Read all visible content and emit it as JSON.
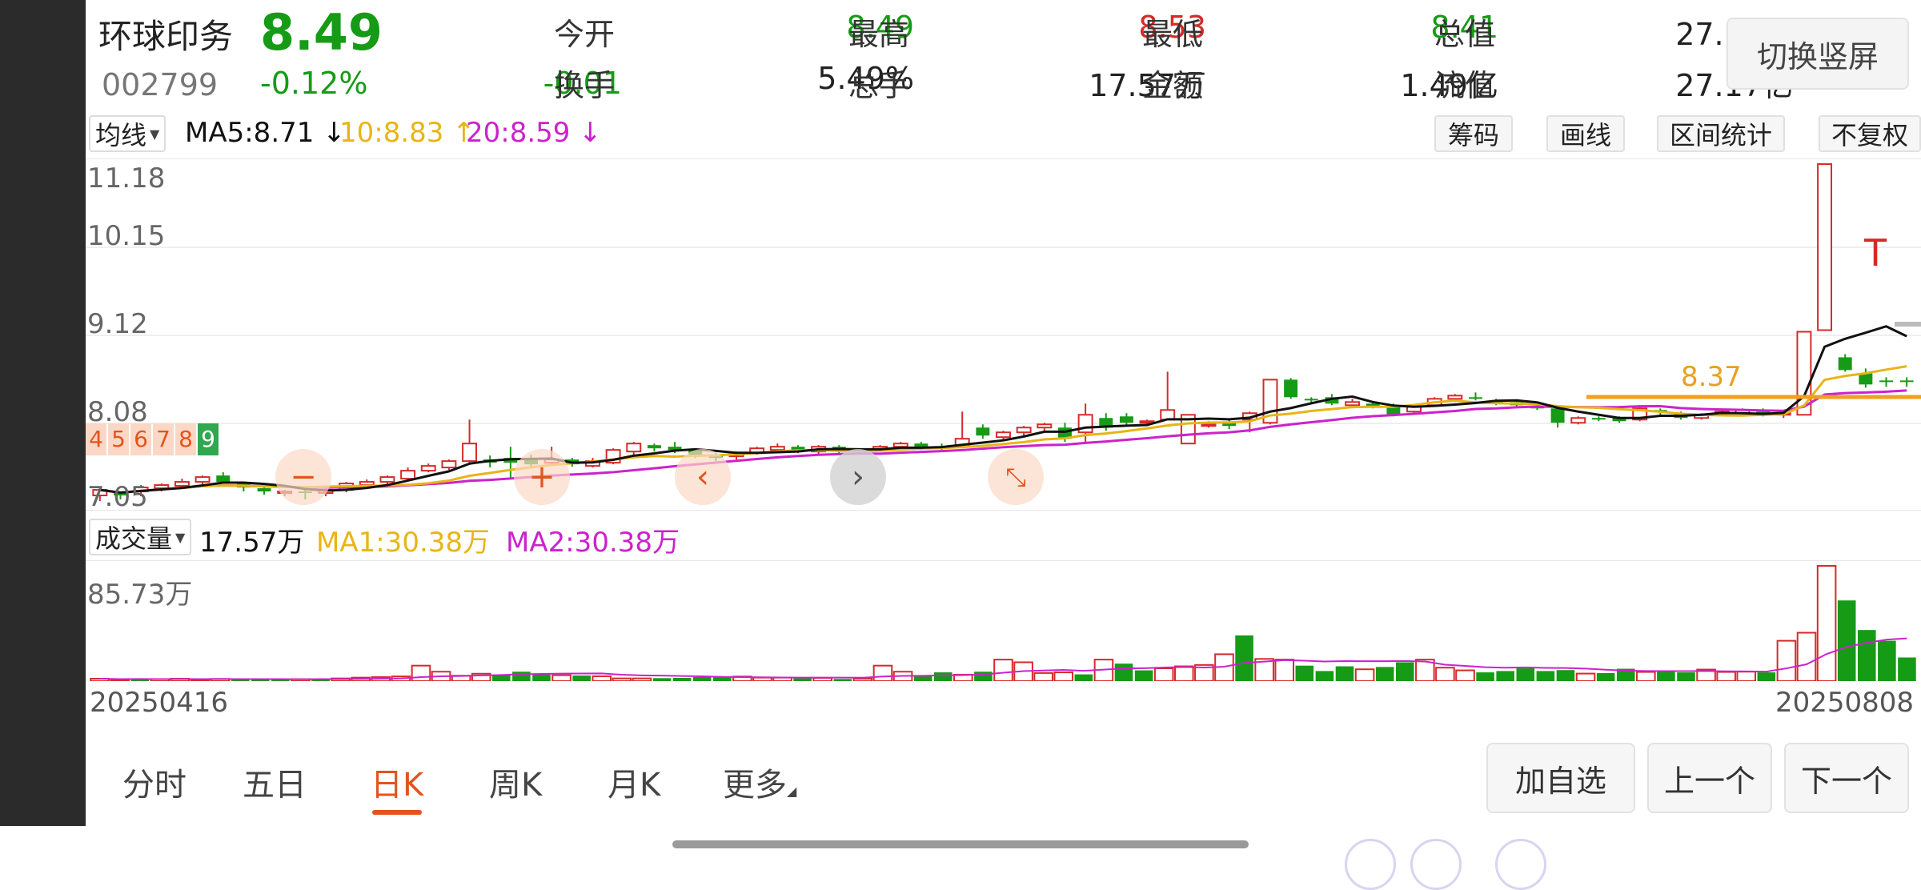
{
  "header": {
    "name": "环球印务",
    "price": "8.49",
    "code": "002799",
    "change_pct": "-0.12%",
    "change": "-0.01",
    "stats": [
      {
        "label": "今开",
        "value": "8.49",
        "color": "green"
      },
      {
        "label": "最高",
        "value": "8.53",
        "color": "red"
      },
      {
        "label": "最低",
        "value": "8.41",
        "color": "green"
      },
      {
        "label": "总值",
        "value": "27.17亿",
        "color": "black"
      },
      {
        "label": "换手",
        "value": "5.49%",
        "color": "black"
      },
      {
        "label": "总手",
        "value": "17.57万",
        "color": "black"
      },
      {
        "label": "金额",
        "value": "1.49亿",
        "color": "black"
      },
      {
        "label": "流值",
        "value": "27.17亿",
        "color": "black"
      }
    ],
    "switch_label": "切换竖屏"
  },
  "ma_legend": {
    "dropdown": "均线",
    "ma5": "MA5:8.71",
    "ma10": "10:8.83",
    "ma20": "20:8.59",
    "ma5_arrow": "↓",
    "ma10_arrow": "↑",
    "ma20_arrow": "↓"
  },
  "tools": [
    "筹码",
    "画线",
    "区间统计",
    "不复权"
  ],
  "price_axis": [
    "11.18",
    "10.15",
    "9.12",
    "8.08",
    "7.05"
  ],
  "overlay": {
    "numbers": [
      "4",
      "5",
      "6",
      "7",
      "8",
      "9"
    ],
    "price_marker": "8.37",
    "t_marker": "T",
    "icons": [
      "minus-icon",
      "plus-icon",
      "chevron-left-icon",
      "chevron-right-icon",
      "collapse-icon"
    ]
  },
  "volume_legend": {
    "dropdown": "成交量",
    "current": "17.57万",
    "ma1": "MA1:30.38万",
    "ma2": "MA2:30.38万"
  },
  "volume_axis_max": "85.73万",
  "dates": {
    "start": "20250416",
    "end": "20250808"
  },
  "tabs": [
    {
      "label": "分时",
      "active": false
    },
    {
      "label": "五日",
      "active": false
    },
    {
      "label": "日K",
      "active": true
    },
    {
      "label": "周K",
      "active": false
    },
    {
      "label": "月K",
      "active": false
    },
    {
      "label": "更多",
      "active": false
    }
  ],
  "actions": [
    "加自选",
    "上一个",
    "下一个"
  ],
  "colors": {
    "up": "#d62a2a",
    "down": "#169b16",
    "ma5": "#111111",
    "ma10": "#e8b516",
    "ma20": "#cc22cc",
    "accent": "#e3541c"
  },
  "chart_data": {
    "type": "candlestick",
    "ylim": [
      7.05,
      11.18
    ],
    "candles": [
      {
        "o": 7.05,
        "c": 7.12,
        "h": 7.15,
        "l": 6.98
      },
      {
        "o": 7.08,
        "c": 7.05,
        "h": 7.1,
        "l": 7.0
      },
      {
        "o": 7.1,
        "c": 7.15,
        "h": 7.18,
        "l": 7.04
      },
      {
        "o": 7.14,
        "c": 7.18,
        "h": 7.2,
        "l": 7.1
      },
      {
        "o": 7.17,
        "c": 7.22,
        "h": 7.26,
        "l": 7.14
      },
      {
        "o": 7.22,
        "c": 7.28,
        "h": 7.3,
        "l": 7.19
      },
      {
        "o": 7.3,
        "c": 7.22,
        "h": 7.34,
        "l": 7.2
      },
      {
        "o": 7.2,
        "c": 7.15,
        "h": 7.22,
        "l": 7.1
      },
      {
        "o": 7.14,
        "c": 7.1,
        "h": 7.16,
        "l": 7.06
      },
      {
        "o": 7.08,
        "c": 7.1,
        "h": 7.12,
        "l": 7.04
      },
      {
        "o": 7.1,
        "c": 7.08,
        "h": 7.14,
        "l": 7.0
      },
      {
        "o": 7.08,
        "c": 7.12,
        "h": 7.15,
        "l": 7.04
      },
      {
        "o": 7.12,
        "c": 7.2,
        "h": 7.22,
        "l": 7.09
      },
      {
        "o": 7.18,
        "c": 7.22,
        "h": 7.25,
        "l": 7.15
      },
      {
        "o": 7.22,
        "c": 7.28,
        "h": 7.3,
        "l": 7.19
      },
      {
        "o": 7.26,
        "c": 7.36,
        "h": 7.4,
        "l": 7.24
      },
      {
        "o": 7.36,
        "c": 7.42,
        "h": 7.45,
        "l": 7.34
      },
      {
        "o": 7.4,
        "c": 7.48,
        "h": 7.5,
        "l": 7.37
      },
      {
        "o": 7.48,
        "c": 7.7,
        "h": 8.0,
        "l": 7.45
      },
      {
        "o": 7.5,
        "c": 7.46,
        "h": 7.55,
        "l": 7.4
      },
      {
        "o": 7.52,
        "c": 7.46,
        "h": 7.66,
        "l": 7.25
      },
      {
        "o": 7.52,
        "c": 7.44,
        "h": 7.56,
        "l": 7.4
      },
      {
        "o": 7.46,
        "c": 7.5,
        "h": 7.66,
        "l": 7.42
      },
      {
        "o": 7.5,
        "c": 7.44,
        "h": 7.52,
        "l": 7.41
      },
      {
        "o": 7.42,
        "c": 7.48,
        "h": 7.52,
        "l": 7.4
      },
      {
        "o": 7.46,
        "c": 7.62,
        "h": 7.64,
        "l": 7.44
      },
      {
        "o": 7.6,
        "c": 7.7,
        "h": 7.72,
        "l": 7.56
      },
      {
        "o": 7.68,
        "c": 7.64,
        "h": 7.7,
        "l": 7.6
      },
      {
        "o": 7.66,
        "c": 7.62,
        "h": 7.72,
        "l": 7.58
      },
      {
        "o": 7.62,
        "c": 7.56,
        "h": 7.64,
        "l": 7.52
      },
      {
        "o": 7.56,
        "c": 7.52,
        "h": 7.58,
        "l": 7.48
      },
      {
        "o": 7.54,
        "c": 7.58,
        "h": 7.6,
        "l": 7.5
      },
      {
        "o": 7.58,
        "c": 7.64,
        "h": 7.66,
        "l": 7.56
      },
      {
        "o": 7.62,
        "c": 7.66,
        "h": 7.7,
        "l": 7.6
      },
      {
        "o": 7.66,
        "c": 7.6,
        "h": 7.68,
        "l": 7.58
      },
      {
        "o": 7.6,
        "c": 7.66,
        "h": 7.68,
        "l": 7.56
      },
      {
        "o": 7.66,
        "c": 7.6,
        "h": 7.68,
        "l": 7.56
      },
      {
        "o": 7.6,
        "c": 7.62,
        "h": 7.64,
        "l": 7.58
      },
      {
        "o": 7.62,
        "c": 7.66,
        "h": 7.68,
        "l": 7.6
      },
      {
        "o": 7.66,
        "c": 7.7,
        "h": 7.72,
        "l": 7.64
      },
      {
        "o": 7.7,
        "c": 7.66,
        "h": 7.72,
        "l": 7.62
      },
      {
        "o": 7.66,
        "c": 7.64,
        "h": 7.7,
        "l": 7.62
      },
      {
        "o": 7.66,
        "c": 7.76,
        "h": 8.1,
        "l": 7.64
      },
      {
        "o": 7.9,
        "c": 7.8,
        "h": 7.94,
        "l": 7.76
      },
      {
        "o": 7.78,
        "c": 7.84,
        "h": 7.86,
        "l": 7.74
      },
      {
        "o": 7.84,
        "c": 7.9,
        "h": 7.92,
        "l": 7.8
      },
      {
        "o": 7.9,
        "c": 7.94,
        "h": 7.96,
        "l": 7.86
      },
      {
        "o": 7.9,
        "c": 7.76,
        "h": 7.96,
        "l": 7.72
      },
      {
        "o": 7.84,
        "c": 8.06,
        "h": 8.2,
        "l": 7.7
      },
      {
        "o": 8.02,
        "c": 7.9,
        "h": 8.08,
        "l": 7.86
      },
      {
        "o": 8.04,
        "c": 7.96,
        "h": 8.08,
        "l": 7.92
      },
      {
        "o": 7.96,
        "c": 7.98,
        "h": 8.0,
        "l": 7.94
      },
      {
        "o": 8.0,
        "c": 8.12,
        "h": 8.6,
        "l": 8.0
      },
      {
        "o": 7.7,
        "c": 8.06,
        "h": 8.06,
        "l": 7.7
      },
      {
        "o": 7.92,
        "c": 7.94,
        "h": 7.98,
        "l": 7.9
      },
      {
        "o": 7.96,
        "c": 7.92,
        "h": 8.0,
        "l": 7.88
      },
      {
        "o": 8.0,
        "c": 8.08,
        "h": 8.1,
        "l": 7.84
      },
      {
        "o": 7.96,
        "c": 8.5,
        "h": 8.5,
        "l": 7.94
      },
      {
        "o": 8.5,
        "c": 8.28,
        "h": 8.52,
        "l": 8.26
      },
      {
        "o": 8.26,
        "c": 8.24,
        "h": 8.28,
        "l": 8.2
      },
      {
        "o": 8.28,
        "c": 8.2,
        "h": 8.32,
        "l": 8.18
      },
      {
        "o": 8.18,
        "c": 8.22,
        "h": 8.26,
        "l": 8.16
      },
      {
        "o": 8.2,
        "c": 8.16,
        "h": 8.22,
        "l": 8.14
      },
      {
        "o": 8.18,
        "c": 8.06,
        "h": 8.2,
        "l": 8.04
      },
      {
        "o": 8.1,
        "c": 8.16,
        "h": 8.18,
        "l": 8.06
      },
      {
        "o": 8.18,
        "c": 8.26,
        "h": 8.28,
        "l": 8.16
      },
      {
        "o": 8.26,
        "c": 8.3,
        "h": 8.32,
        "l": 8.22
      },
      {
        "o": 8.28,
        "c": 8.26,
        "h": 8.34,
        "l": 8.24
      },
      {
        "o": 8.24,
        "c": 8.2,
        "h": 8.26,
        "l": 8.18
      },
      {
        "o": 8.22,
        "c": 8.18,
        "h": 8.24,
        "l": 8.14
      },
      {
        "o": 8.16,
        "c": 8.14,
        "h": 8.18,
        "l": 8.12
      },
      {
        "o": 8.14,
        "c": 7.96,
        "h": 8.16,
        "l": 7.9
      },
      {
        "o": 7.96,
        "c": 8.02,
        "h": 8.04,
        "l": 7.94
      },
      {
        "o": 8.02,
        "c": 8.0,
        "h": 8.04,
        "l": 7.98
      },
      {
        "o": 8.02,
        "c": 7.98,
        "h": 8.04,
        "l": 7.96
      },
      {
        "o": 8.0,
        "c": 8.14,
        "h": 8.16,
        "l": 7.98
      },
      {
        "o": 8.12,
        "c": 8.1,
        "h": 8.14,
        "l": 8.06
      },
      {
        "o": 8.08,
        "c": 8.02,
        "h": 8.1,
        "l": 8.0
      },
      {
        "o": 8.02,
        "c": 8.06,
        "h": 8.08,
        "l": 8.0
      },
      {
        "o": 8.06,
        "c": 8.1,
        "h": 8.12,
        "l": 8.04
      },
      {
        "o": 8.08,
        "c": 8.12,
        "h": 8.14,
        "l": 8.04
      },
      {
        "o": 8.1,
        "c": 8.06,
        "h": 8.14,
        "l": 8.04
      },
      {
        "o": 8.06,
        "c": 8.08,
        "h": 8.1,
        "l": 8.02
      },
      {
        "o": 8.06,
        "c": 9.1,
        "h": 9.1,
        "l": 8.06
      },
      {
        "o": 9.12,
        "c": 11.2,
        "h": 11.2,
        "l": 9.12
      },
      {
        "o": 8.78,
        "c": 8.62,
        "h": 8.82,
        "l": 8.6
      },
      {
        "o": 8.58,
        "c": 8.44,
        "h": 8.64,
        "l": 8.4
      },
      {
        "o": 8.49,
        "c": 8.48,
        "h": 8.53,
        "l": 8.41
      },
      {
        "o": 8.49,
        "c": 8.48,
        "h": 8.53,
        "l": 8.41
      }
    ],
    "volume": [
      1.8,
      1.2,
      1.6,
      1.5,
      1.8,
      1.2,
      1.6,
      1.3,
      1.4,
      1.2,
      1.4,
      1.8,
      2.0,
      2.6,
      3.0,
      3.5,
      11.5,
      7.0,
      4.0,
      5.5,
      4.8,
      7.0,
      5.0,
      4.4,
      4.2,
      3.6,
      2.0,
      2.0,
      2.2,
      2.4,
      3.0,
      2.8,
      3.4,
      2.6,
      2.6,
      2.8,
      2.4,
      1.6,
      1.8,
      11.5,
      7.0,
      4.0,
      6.5,
      4.8,
      7.0,
      16.0,
      14.0,
      6.0,
      6.5,
      5.0,
      16.0,
      13.0,
      8.0,
      9.5,
      11.0,
      12.0,
      20.0,
      34.0,
      16.5,
      16.0,
      11.5,
      7.5,
      11.0,
      8.8,
      10.5,
      14.0,
      16.0,
      10.0,
      8.0,
      6.5,
      7.5,
      9.5,
      7.5,
      8.2,
      5.6,
      6.0,
      9.2,
      6.8,
      7.5,
      6.5,
      8.6,
      6.8,
      7.0,
      6.5,
      30.0,
      36.0,
      85.73,
      60.0,
      38.0,
      30.0,
      17.57
    ]
  }
}
